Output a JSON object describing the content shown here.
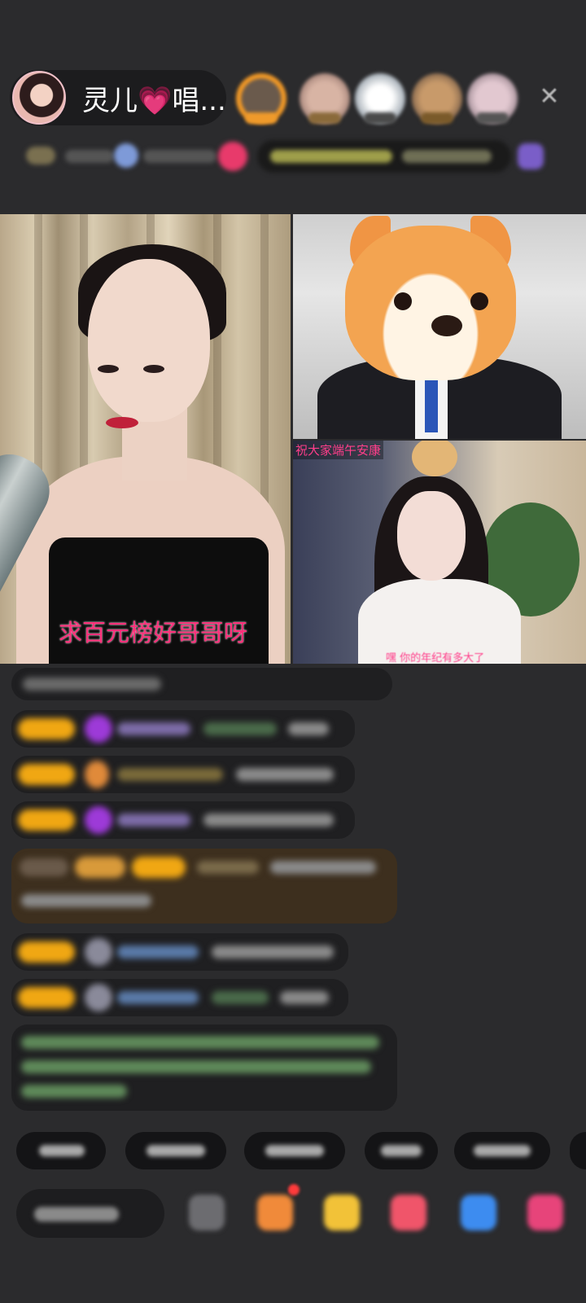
{
  "header": {
    "host_name": "灵儿",
    "host_heart": "💗",
    "host_suffix": "唱...",
    "close_label": "✕"
  },
  "video": {
    "main_caption": "求百元榜好哥哥呀",
    "right_bottom_caption_top": "祝大家端午安康",
    "right_bottom_caption_bottom": "嘿 你的年纪有多大了"
  },
  "colors": {
    "background": "#2b2b2d",
    "caption_pink": "#ff2f7a",
    "badge_gold": "#f0a713",
    "chat_bubble": "#1f1f21"
  }
}
